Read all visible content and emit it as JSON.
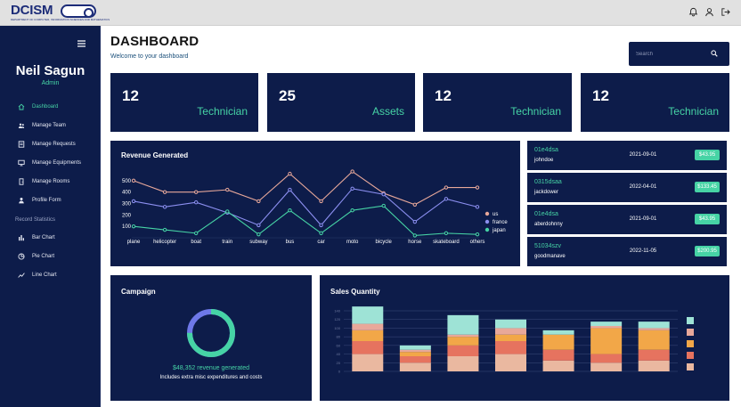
{
  "brand": {
    "logo_text": "DCISM",
    "tagline": "DEPARTMENT OF COMPUTER, INFORMATION SCIENCES AND MATHEMATICS"
  },
  "topbar_icons": [
    "bell-icon",
    "user-icon",
    "logout-icon"
  ],
  "sidebar": {
    "user_name": "Neil Sagun",
    "user_role": "Admin",
    "items": [
      {
        "label": "Dashboard",
        "icon": "home-icon",
        "active": true
      },
      {
        "label": "Manage Team",
        "icon": "team-icon"
      },
      {
        "label": "Manage Requests",
        "icon": "requests-icon"
      },
      {
        "label": "Manage Equipments",
        "icon": "monitor-icon"
      },
      {
        "label": "Manage Rooms",
        "icon": "door-icon"
      },
      {
        "label": "Profile Form",
        "icon": "person-icon"
      }
    ],
    "section_title": "Record Statistics",
    "stats_items": [
      {
        "label": "Bar Chart",
        "icon": "bar-chart-icon"
      },
      {
        "label": "Pie Chart",
        "icon": "pie-chart-icon"
      },
      {
        "label": "Line Chart",
        "icon": "line-chart-icon"
      }
    ]
  },
  "header": {
    "title": "DASHBOARD",
    "subtitle": "Welcome to your dashboard"
  },
  "search": {
    "placeholder": "Search"
  },
  "stat_cards": [
    {
      "value": "12",
      "label": "Technician"
    },
    {
      "value": "25",
      "label": "Assets"
    },
    {
      "value": "12",
      "label": "Technician"
    },
    {
      "value": "12",
      "label": "Technician"
    }
  ],
  "revenue": {
    "title": "Revenue Generated"
  },
  "transactions": [
    {
      "id": "01e4dsa",
      "user": "johndoe",
      "date": "2021-09-01",
      "cost": "$43.95"
    },
    {
      "id": "0315dsaa",
      "user": "jackdower",
      "date": "2022-04-01",
      "cost": "$133.45"
    },
    {
      "id": "01e4dsa",
      "user": "aberdohnny",
      "date": "2021-09-01",
      "cost": "$43.95"
    },
    {
      "id": "51034szv",
      "user": "goodmanave",
      "date": "2022-11-05",
      "cost": "$200.95"
    }
  ],
  "campaign": {
    "title": "Campaign",
    "progress": 0.75,
    "revenue_text": "$48,352 revenue generated",
    "note": "Includes extra misc expenditures and costs"
  },
  "sales": {
    "title": "Sales Quantity"
  },
  "colors": {
    "navy": "#0d1c4a",
    "accent": "#46d3a5",
    "line_us": "#e8a89a",
    "line_france": "#8c8ff0",
    "line_japan": "#46d3a5",
    "bar_segments": [
      "#eab8a0",
      "#e6735f",
      "#f2a748",
      "#e8a89a",
      "#9ee3d6"
    ]
  },
  "chart_data": [
    {
      "type": "line",
      "title": "Revenue Generated",
      "categories": [
        "plane",
        "helicopter",
        "boat",
        "train",
        "subway",
        "bus",
        "car",
        "moto",
        "bicycle",
        "horse",
        "skateboard",
        "others"
      ],
      "ylim": [
        0,
        600
      ],
      "yticks": [
        100,
        200,
        300,
        400,
        500
      ],
      "legend": "right",
      "series": [
        {
          "name": "us",
          "color": "#e8a89a",
          "values": [
            500,
            400,
            400,
            420,
            320,
            560,
            320,
            580,
            390,
            290,
            440,
            440
          ]
        },
        {
          "name": "france",
          "color": "#8c8ff0",
          "values": [
            320,
            270,
            310,
            220,
            110,
            420,
            110,
            430,
            380,
            140,
            340,
            270
          ]
        },
        {
          "name": "japan",
          "color": "#46d3a5",
          "values": [
            100,
            70,
            40,
            230,
            30,
            240,
            40,
            240,
            280,
            20,
            40,
            30
          ]
        }
      ]
    },
    {
      "type": "bar",
      "title": "Sales Quantity",
      "categories": [
        "",
        "",
        "",
        "",
        "",
        "",
        ""
      ],
      "ylim": [
        0,
        140
      ],
      "yticks": [
        0,
        20,
        40,
        60,
        80,
        100,
        120,
        140
      ],
      "stacked": true,
      "series": [
        {
          "name": "",
          "color": "#eab8a0",
          "values": [
            40,
            20,
            35,
            40,
            25,
            20,
            25
          ]
        },
        {
          "name": "",
          "color": "#e6735f",
          "values": [
            30,
            15,
            25,
            30,
            25,
            20,
            25
          ]
        },
        {
          "name": "",
          "color": "#f2a748",
          "values": [
            25,
            10,
            20,
            15,
            35,
            60,
            45
          ]
        },
        {
          "name": "",
          "color": "#e8a89a",
          "values": [
            15,
            5,
            5,
            15,
            0,
            5,
            5
          ]
        },
        {
          "name": "",
          "color": "#9ee3d6",
          "values": [
            40,
            10,
            45,
            20,
            10,
            10,
            15
          ]
        }
      ],
      "legend": "right"
    }
  ]
}
